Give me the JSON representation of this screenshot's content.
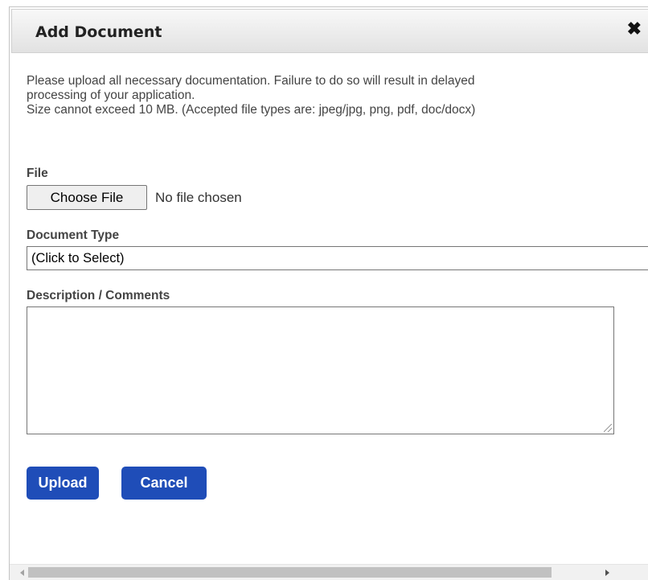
{
  "dialog": {
    "title": "Add Document",
    "close_glyph": "✖"
  },
  "instructions": {
    "line1": "Please upload all necessary documentation. Failure to do so will result in delayed",
    "line2": "processing of your application.",
    "line3": "Size cannot exceed 10 MB. (Accepted file types are: jpeg/jpg, png, pdf, doc/docx)"
  },
  "file": {
    "label": "File",
    "button_label": "Choose File",
    "status": "No file chosen"
  },
  "document_type": {
    "label": "Document Type",
    "selected": "(Click to Select)"
  },
  "description": {
    "label": "Description / Comments",
    "value": ""
  },
  "actions": {
    "upload": "Upload",
    "cancel": "Cancel"
  }
}
